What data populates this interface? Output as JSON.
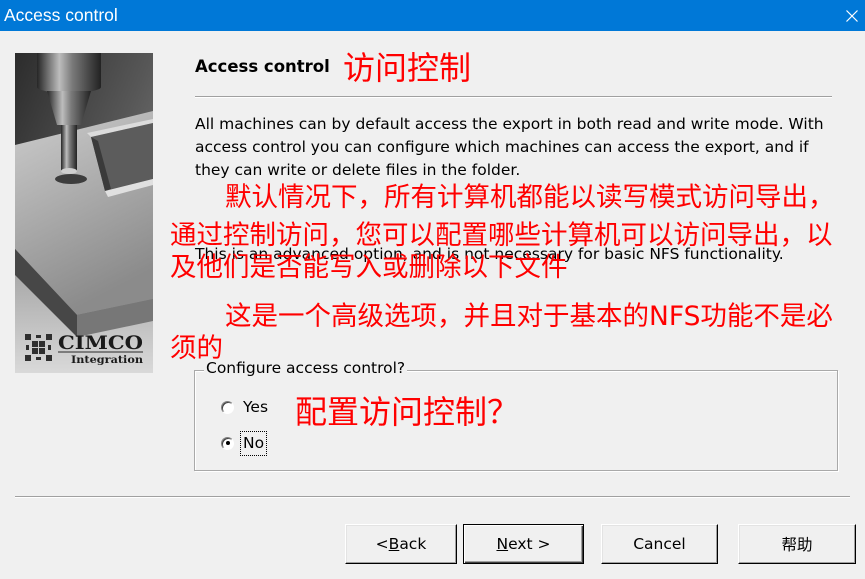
{
  "window": {
    "title": "Access control",
    "close_icon": "close-icon"
  },
  "colors": {
    "title_bar": "#0078d7",
    "dialog_bg": "#f0f0f0",
    "annotation": "#ff0000"
  },
  "sidebar_image": {
    "logo_name": "CIMCO",
    "logo_tagline": "Integration"
  },
  "header": {
    "title": "Access control",
    "annotation": "访问控制"
  },
  "intro_lines": [
    "All machines can by default access the export in both read and write mode. With",
    "access control you can configure which machines can access the export, and if",
    "they can write or delete files in the folder."
  ],
  "intro_annotation_lines": [
    "默认情况下，所有计算机都能以读写模式访问导出，",
    "通过控制访问，您可以配置哪些计算机可以访问导出，以",
    "及他们是否能写入或删除以下文件"
  ],
  "advanced_note": "This is an advanced option, and is not necessary for basic NFS functionality.",
  "advanced_annotation_lines": [
    "这是一个高级选项，并且对于基本的NFS功能不是必",
    "须的"
  ],
  "access_group": {
    "label": "Configure access control?",
    "annotation": "配置访问控制？",
    "options": [
      {
        "label": "Yes",
        "selected": false,
        "focused": false
      },
      {
        "label": "No",
        "selected": true,
        "focused": true
      }
    ]
  },
  "buttons": {
    "back": "< Back",
    "next": "Next >",
    "cancel": "Cancel",
    "help": "帮助"
  }
}
